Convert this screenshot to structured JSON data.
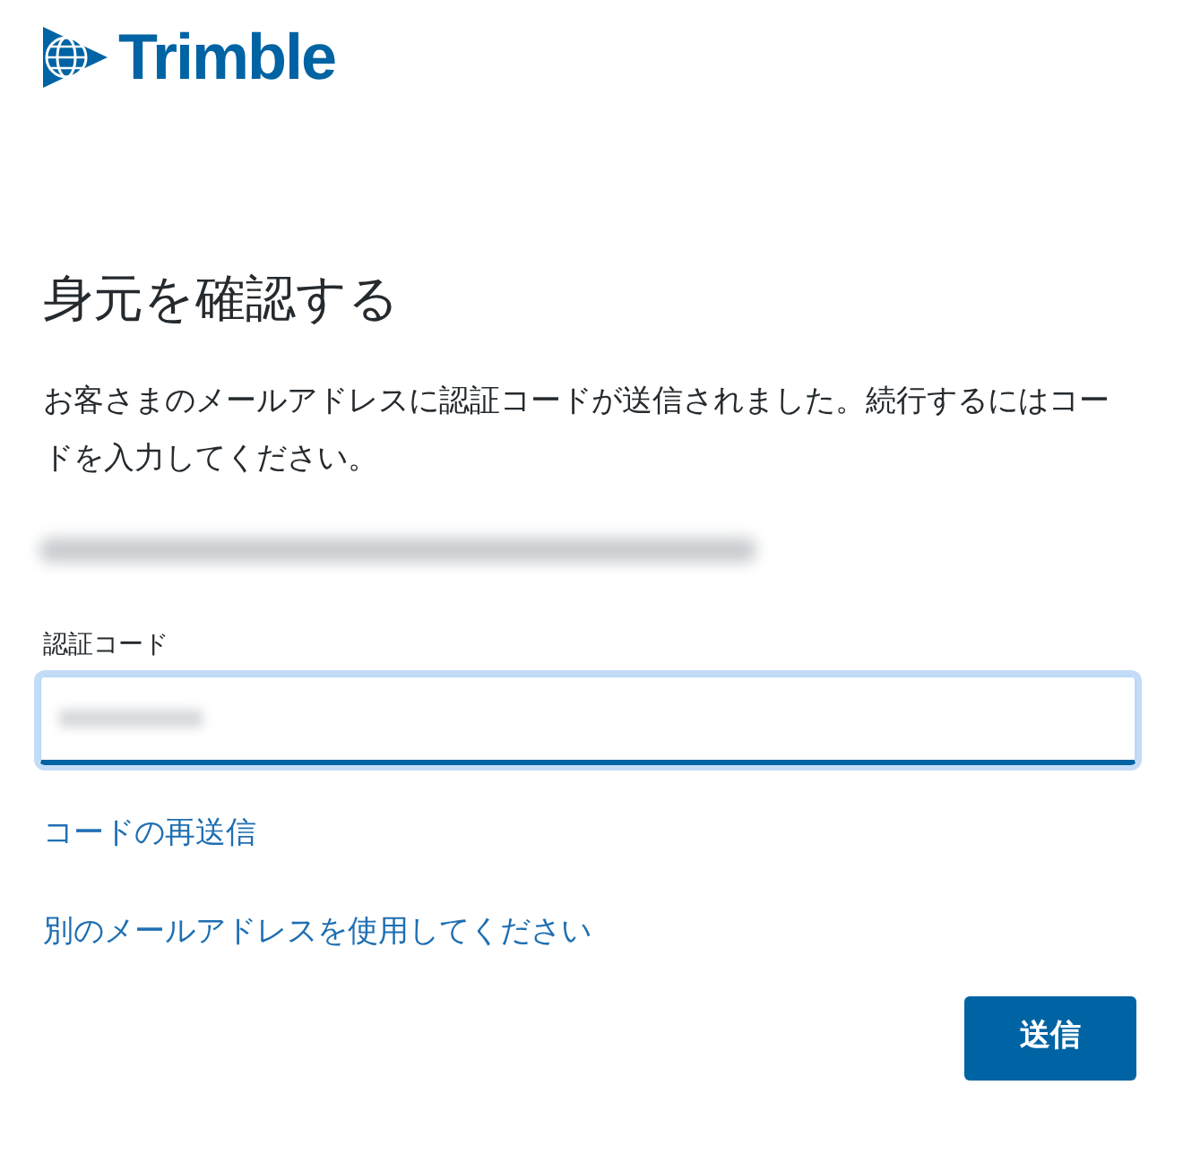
{
  "logo": {
    "text": "Trimble"
  },
  "heading": "身元を確認する",
  "message": "お客さまのメールアドレスに認証コードが送信されました。続行するにはコードを入力してください。",
  "code_field": {
    "label": "認証コード",
    "focused": true
  },
  "links": [
    "コードの再送信",
    "別のメールアドレスを使用してください"
  ],
  "submit_button": "送信"
}
